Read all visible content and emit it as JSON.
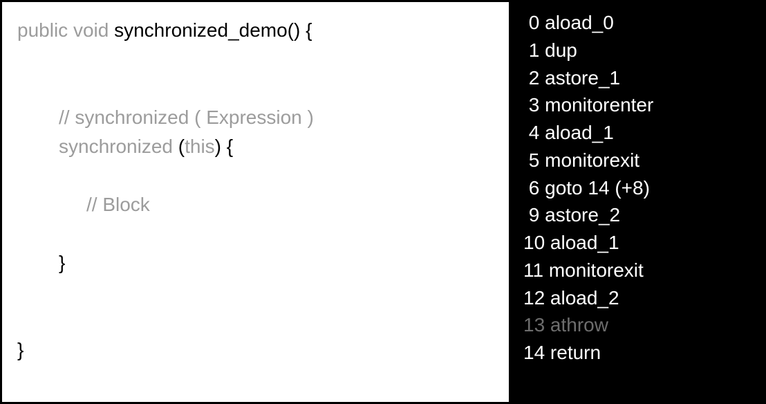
{
  "source": {
    "signature_prefix": "public void ",
    "method_name": "synchronized_demo() {",
    "comment_expression": "// synchronized ( Expression )",
    "sync_keyword": "synchronized ",
    "sync_paren_open": "(",
    "sync_this": "this",
    "sync_paren_close": ") {",
    "comment_block": "// Block",
    "close_inner": "}",
    "close_outer": "}"
  },
  "bytecode": [
    {
      "offset": " 0",
      "instr": " aload_0",
      "style": "normal"
    },
    {
      "offset": " 1",
      "instr": " dup",
      "style": "normal"
    },
    {
      "offset": " 2",
      "instr": " astore_1",
      "style": "normal"
    },
    {
      "offset": " 3",
      "instr": " monitorenter",
      "style": "normal"
    },
    {
      "offset": " 4",
      "instr": " aload_1",
      "style": "normal"
    },
    {
      "offset": " 5",
      "instr": " monitorexit",
      "style": "normal"
    },
    {
      "offset": " 6",
      "instr": " goto 14 (+8)",
      "style": "normal"
    },
    {
      "offset": " 9",
      "instr": " astore_2",
      "style": "normal"
    },
    {
      "offset": "10",
      "instr": " aload_1",
      "style": "normal"
    },
    {
      "offset": "11",
      "instr": " monitorexit",
      "style": "normal"
    },
    {
      "offset": "12",
      "instr": " aload_2",
      "style": "normal"
    },
    {
      "offset": "13",
      "instr": " athrow",
      "style": "dim"
    },
    {
      "offset": "14",
      "instr": " return",
      "style": "normal"
    }
  ]
}
